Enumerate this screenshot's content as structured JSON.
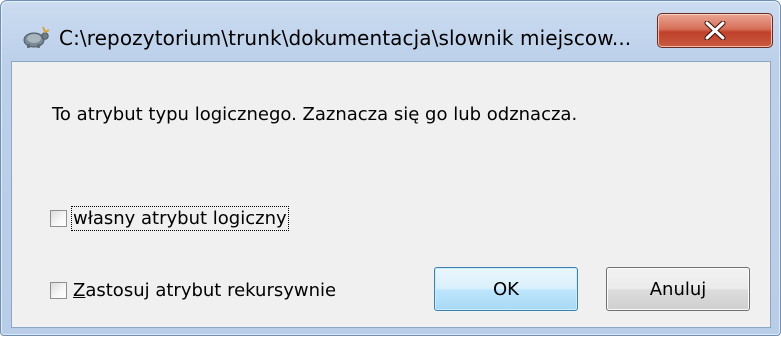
{
  "window": {
    "title": "C:\\repozytorium\\trunk\\dokumentacja\\slownik miejscow..."
  },
  "icons": {
    "app": "tortoisesvn-app-icon",
    "close": "close-icon"
  },
  "dialog": {
    "message": "To atrybut typu logicznego. Zaznacza się go lub odznacza.",
    "checkbox_value": {
      "label": "własny atrybut logiczny",
      "checked": false
    },
    "checkbox_recursive": {
      "label_accel": "Z",
      "label_rest": "astosuj atrybut rekursywnie",
      "checked": false
    },
    "ok_label": "OK",
    "cancel_label": "Anuluj"
  },
  "colors": {
    "close_button": "#c8452e",
    "default_button_border": "#3c7fb1",
    "frame": "#bcd0ea"
  }
}
